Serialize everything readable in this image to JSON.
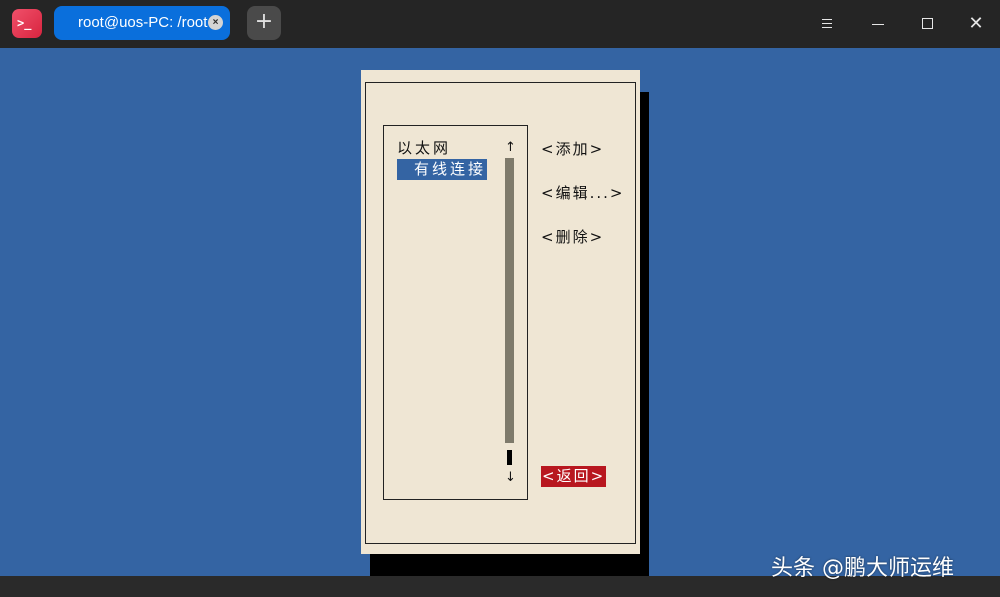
{
  "titlebar": {
    "app_icon": "terminal-icon",
    "app_icon_glyph": ">_",
    "tab_title": "root@uos-PC: /root",
    "tab_close_glyph": "×",
    "new_tab_glyph": "+",
    "close_glyph": "✕",
    "accent_color": "#0a6fdc"
  },
  "dialog": {
    "list": {
      "category": "以太网",
      "selected_item": "有线连接",
      "scroll_up_glyph": "↑",
      "scroll_down_glyph": "↓"
    },
    "actions": {
      "add": "<添加>",
      "edit": "<编辑...>",
      "delete": "<删除>",
      "back": "<返回>"
    },
    "colors": {
      "background": "#efe6d4",
      "selection": "#3464a3",
      "focus_button": "#b8171f",
      "desktop": "#3464a3"
    }
  },
  "watermark": "头条 @鹏大师运维"
}
